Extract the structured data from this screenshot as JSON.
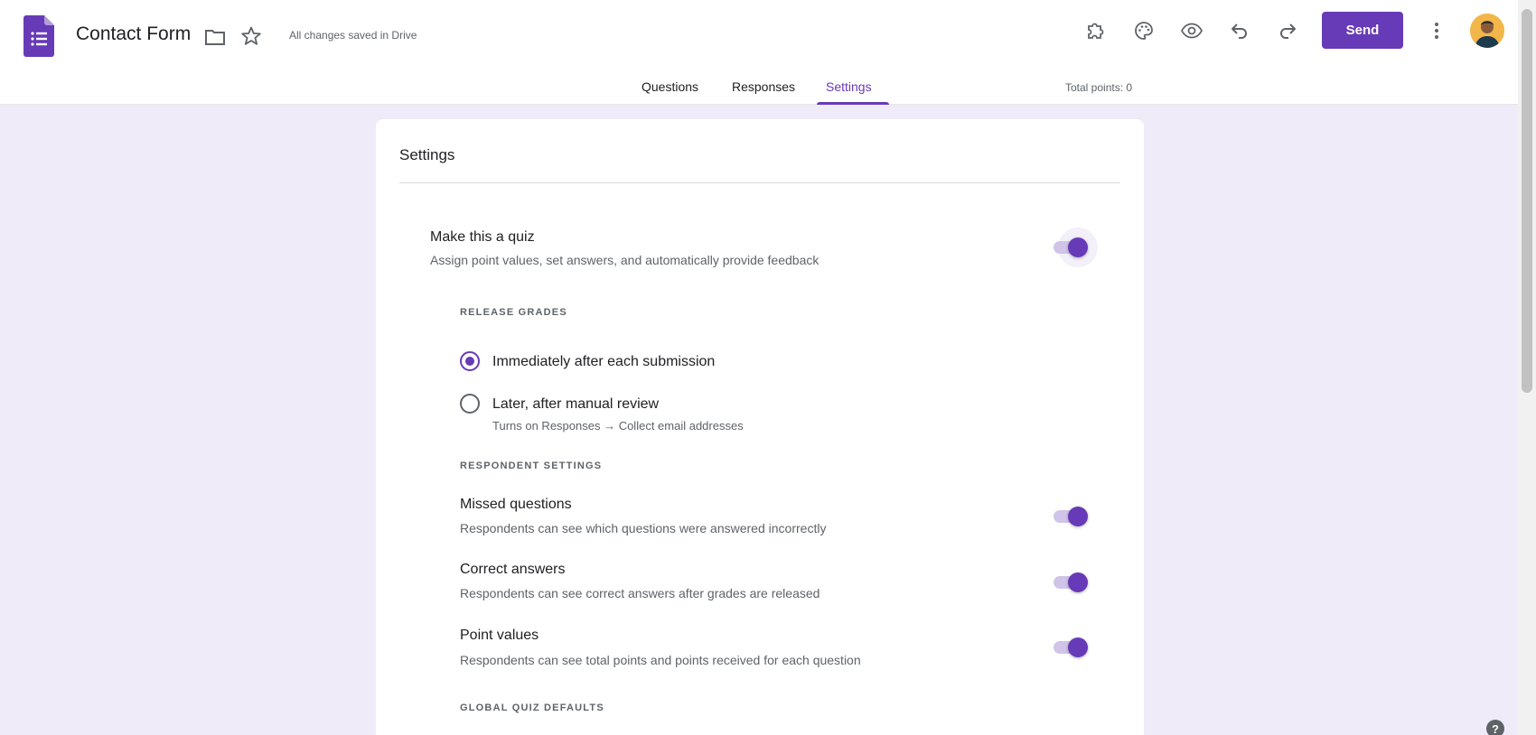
{
  "header": {
    "title": "Contact Form",
    "saved_status": "All changes saved in Drive",
    "send_label": "Send"
  },
  "tabs": [
    {
      "label": "Questions",
      "active": false
    },
    {
      "label": "Responses",
      "active": false
    },
    {
      "label": "Settings",
      "active": true
    }
  ],
  "total_points": "Total points: 0",
  "settings": {
    "title": "Settings",
    "quiz": {
      "title": "Make this a quiz",
      "description": "Assign point values, set answers, and automatically provide feedback",
      "enabled": true
    },
    "release_grades": {
      "label": "RELEASE GRADES",
      "options": [
        {
          "label": "Immediately after each submission",
          "sublabel": "",
          "selected": true
        },
        {
          "label": "Later, after manual review",
          "sublabel": "Turns on Responses → Collect email addresses",
          "selected": false
        }
      ]
    },
    "respondent_settings": {
      "label": "RESPONDENT SETTINGS",
      "items": [
        {
          "title": "Missed questions",
          "description": "Respondents can see which questions were answered incorrectly",
          "enabled": true
        },
        {
          "title": "Correct answers",
          "description": "Respondents can see correct answers after grades are released",
          "enabled": true
        },
        {
          "title": "Point values",
          "description": "Respondents can see total points and points received for each question",
          "enabled": true
        }
      ]
    },
    "global_defaults_label": "GLOBAL QUIZ DEFAULTS"
  },
  "help_label": "?",
  "colors": {
    "accent": "#673ab7",
    "background": "#f0ebf8"
  }
}
